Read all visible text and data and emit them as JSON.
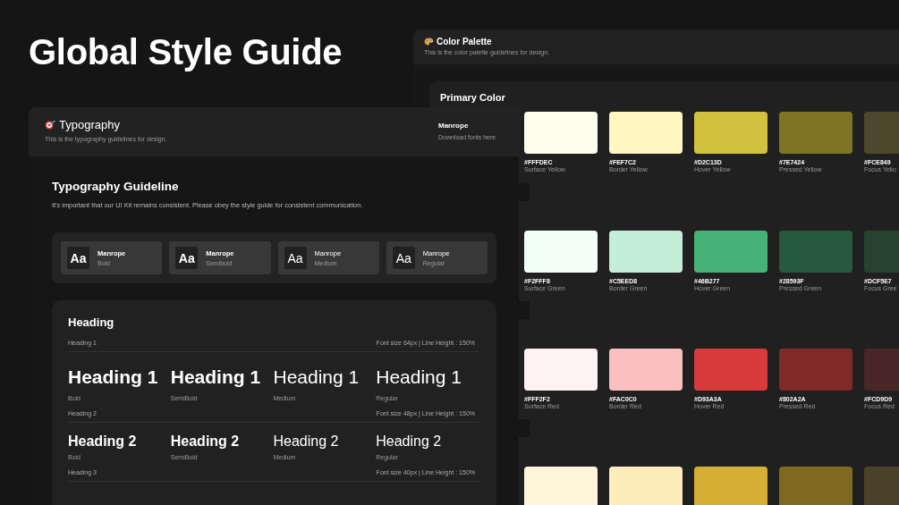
{
  "title": "Global Style Guide",
  "color_palette": {
    "title": "Color Palette",
    "subtitle": "This is the color palette guidelines for design.",
    "section_title": "Primary Color",
    "rows": [
      {
        "swatches": [
          {
            "color": "#fffdec",
            "hex": "#FFFDEC",
            "name": "Surface Yellow"
          },
          {
            "color": "#fef7c2",
            "hex": "#FEF7C2",
            "name": "Border Yellow"
          },
          {
            "color": "#d2c13d",
            "hex": "#D2C13D",
            "name": "Hover Yellow"
          },
          {
            "color": "#7e7424",
            "hex": "#7E7424",
            "name": "Pressed Yellow"
          },
          {
            "color": "#4b482c",
            "hex": "#FCE849",
            "name": "Focus Yello"
          }
        ]
      },
      {
        "swatches": [
          {
            "color": "#f2fff8",
            "hex": "#F2FFF8",
            "name": "Surface Green"
          },
          {
            "color": "#c5eed8",
            "hex": "#C5EED8",
            "name": "Border Green"
          },
          {
            "color": "#46b277",
            "hex": "#46B277",
            "name": "Hover Green"
          },
          {
            "color": "#28593f",
            "hex": "#28593F",
            "name": "Pressed Green"
          },
          {
            "color": "#27432f",
            "hex": "#DCF5E7",
            "name": "Focus Gree"
          }
        ]
      },
      {
        "swatches": [
          {
            "color": "#fff2f2",
            "hex": "#FFF2F2",
            "name": "Surface Red"
          },
          {
            "color": "#fac0c0",
            "hex": "#FAC0C0",
            "name": "Border Red"
          },
          {
            "color": "#d93a3a",
            "hex": "#D93A3A",
            "name": "Hover Red"
          },
          {
            "color": "#802a2a",
            "hex": "#802A2A",
            "name": "Pressed Red"
          },
          {
            "color": "#4a2626",
            "hex": "#FCD9D9",
            "name": "Focus Red"
          }
        ]
      },
      {
        "swatches": [
          {
            "color": "#fff5da"
          },
          {
            "color": "#fdedbb"
          },
          {
            "color": "#d4af33"
          },
          {
            "color": "#7f6920"
          },
          {
            "color": "#4b4128"
          }
        ]
      }
    ]
  },
  "typography": {
    "title": "Typography",
    "subtitle": "This is the typography guidelines for design.",
    "font_name": "Manrope",
    "font_link": "Download fonts here",
    "guideline_title": "Typography Guideline",
    "guideline_text": "It's important that our UI Kit remains consistent. Please obey the style guide for consistent communication.",
    "fonts": [
      {
        "sample": "Aa",
        "name": "Manrope",
        "weight": "Bold"
      },
      {
        "sample": "Aa",
        "name": "Manrope",
        "weight": "Semibold"
      },
      {
        "sample": "Aa",
        "name": "Manrope",
        "weight": "Medium"
      },
      {
        "sample": "Aa",
        "name": "Manrope",
        "weight": "Regular"
      }
    ],
    "heading_section": {
      "title": "Heading",
      "levels": [
        {
          "label": "Heading 1",
          "spec": "Font size 64px | Line Height : 150%",
          "samples": [
            {
              "text": "Heading 1",
              "weight": "Bold"
            },
            {
              "text": "Heading 1",
              "weight": "SemiBold"
            },
            {
              "text": "Heading 1",
              "weight": "Medium"
            },
            {
              "text": "Heading 1",
              "weight": "Regular"
            }
          ]
        },
        {
          "label": "Heading 2",
          "spec": "Font size 48px | Line Height : 150%",
          "samples": [
            {
              "text": "Heading 2",
              "weight": "Bold"
            },
            {
              "text": "Heading 2",
              "weight": "SemiBold"
            },
            {
              "text": "Heading 2",
              "weight": "Medium"
            },
            {
              "text": "Heading 2",
              "weight": "Regular"
            }
          ]
        },
        {
          "label": "Heading 3",
          "spec": "Font size 40px | Line Height : 150%"
        }
      ]
    }
  }
}
